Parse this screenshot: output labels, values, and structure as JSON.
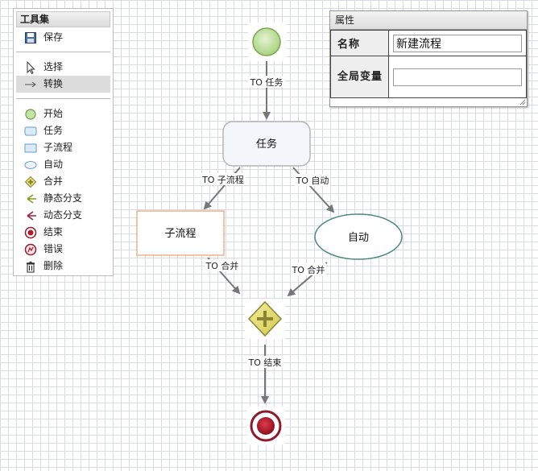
{
  "toolbox": {
    "title": "工具集",
    "items": [
      {
        "label": "保存",
        "icon": "save-icon"
      },
      {
        "label": "选择",
        "icon": "cursor-icon"
      },
      {
        "label": "转换",
        "icon": "arrow-right-icon"
      },
      {
        "label": "开始",
        "icon": "start-event-icon"
      },
      {
        "label": "任务",
        "icon": "task-icon"
      },
      {
        "label": "子流程",
        "icon": "subprocess-icon"
      },
      {
        "label": "自动",
        "icon": "auto-icon"
      },
      {
        "label": "合并",
        "icon": "merge-gateway-icon"
      },
      {
        "label": "静态分支",
        "icon": "static-branch-icon"
      },
      {
        "label": "动态分支",
        "icon": "dynamic-branch-icon"
      },
      {
        "label": "结束",
        "icon": "end-event-icon"
      },
      {
        "label": "错误",
        "icon": "error-event-icon"
      },
      {
        "label": "删除",
        "icon": "trash-icon"
      }
    ],
    "selected": "转换"
  },
  "properties": {
    "title": "属性",
    "rows": [
      {
        "label": "名称",
        "value": "新建流程"
      },
      {
        "label": "全局变量",
        "value": ""
      }
    ]
  },
  "diagram": {
    "nodes": {
      "task": "任务",
      "subprocess": "子流程",
      "auto": "自动"
    },
    "edges": {
      "to_task": "TO 任务",
      "to_subprocess": "TO 子流程",
      "to_auto": "TO 自动",
      "to_merge_left": "TO 合并",
      "to_merge_right": "TO 合并",
      "to_end": "TO 结束"
    }
  },
  "colors": {
    "start_fill": "#c5e3a4",
    "end_fill": "#b01a2a",
    "gateway_fill": "#e6df76",
    "task_fill": "#f5f5fc",
    "subprocess_border": "#f0b08a",
    "auto_border": "#4c8a7c",
    "edge": "#777777"
  }
}
